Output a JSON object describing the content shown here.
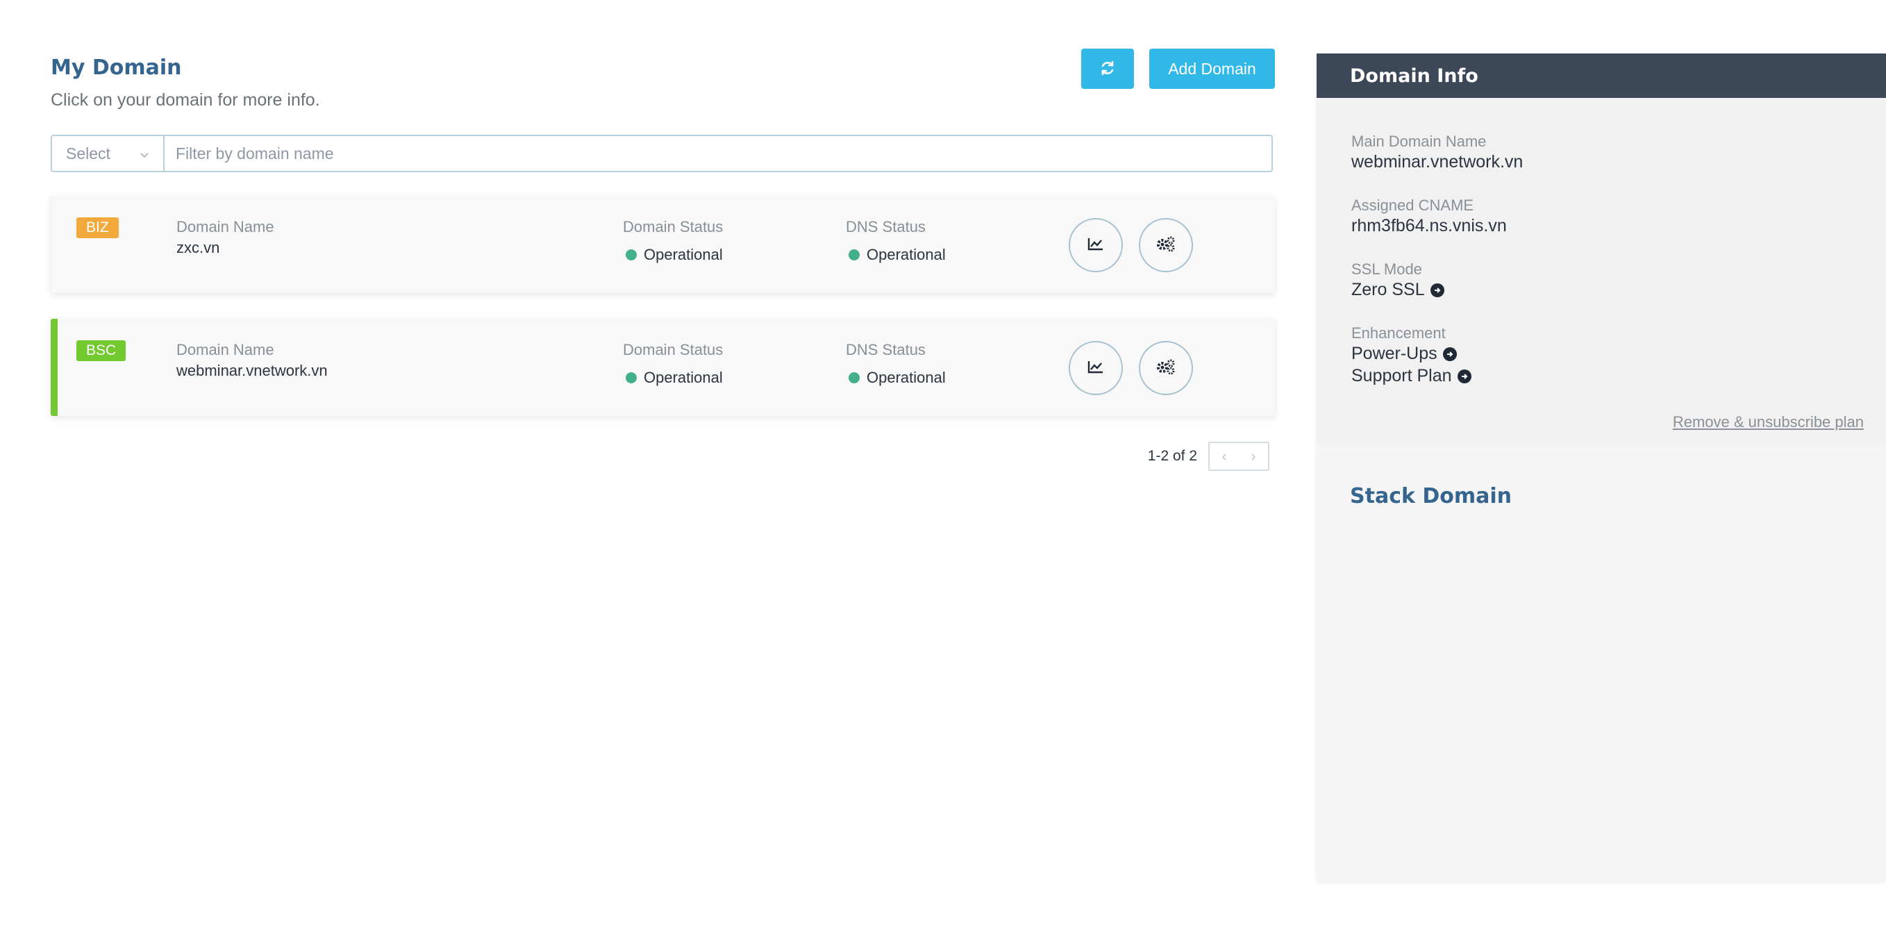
{
  "header": {
    "title": "My Domain",
    "subtitle": "Click on your domain for more info.",
    "add_button_label": "Add Domain",
    "refresh_icon": "refresh-icon"
  },
  "filter": {
    "select_label": "Select",
    "placeholder": "Filter by domain name"
  },
  "domains": [
    {
      "plan": "BIZ",
      "plan_color": "#f2a93b",
      "name_label": "Domain Name",
      "name": "zxc.vn",
      "domain_status_label": "Domain Status",
      "domain_status": "Operational",
      "dns_status_label": "DNS Status",
      "dns_status": "Operational",
      "active": false
    },
    {
      "plan": "BSC",
      "plan_color": "#73c930",
      "name_label": "Domain Name",
      "name": "webminar.vnetwork.vn",
      "domain_status_label": "Domain Status",
      "domain_status": "Operational",
      "dns_status_label": "DNS Status",
      "dns_status": "Operational",
      "active": true
    }
  ],
  "pagination": {
    "info": "1-2 of 2",
    "prev": "‹",
    "next": "›"
  },
  "domain_info": {
    "title": "Domain Info",
    "main_domain_label": "Main Domain Name",
    "main_domain": "webminar.vnetwork.vn",
    "cname_label": "Assigned CNAME",
    "cname": "rhm3fb64.ns.vnis.vn",
    "ssl_label": "SSL Mode",
    "ssl": "Zero SSL",
    "enhancement_label": "Enhancement",
    "power_ups": "Power-Ups",
    "support_plan": "Support Plan",
    "remove_link": "Remove & unsubscribe plan"
  },
  "stack": {
    "title": "Stack Domain"
  },
  "colors": {
    "accent": "#32b8e6",
    "title": "#35648f",
    "status_ok": "#43b08a",
    "panel_header": "#3c4858"
  }
}
